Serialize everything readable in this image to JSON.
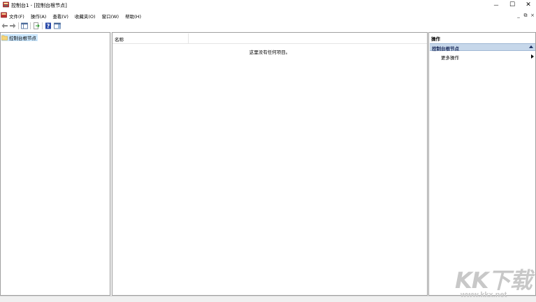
{
  "window": {
    "title": "控制台1 - [控制台根节点]",
    "minimize_glyph": "—",
    "maximize_glyph": "☐",
    "close_glyph": "✕"
  },
  "menubar": {
    "items": [
      "文件(F)",
      "操作(A)",
      "查看(V)",
      "收藏夹(O)",
      "窗口(W)",
      "帮助(H)"
    ],
    "mdi_minimize": "_",
    "mdi_restore": "⧉",
    "mdi_close": "×"
  },
  "toolbar": {
    "icons": [
      "back-arrow-icon",
      "forward-arrow-icon",
      "show-hide-console-tree-icon",
      "export-list-icon",
      "help-icon",
      "show-hide-action-pane-icon"
    ]
  },
  "tree": {
    "root_label": "控制台根节点"
  },
  "list": {
    "column_name": "名称",
    "empty_message": "这里没有任何项目。"
  },
  "actions": {
    "title": "操作",
    "section_label": "控制台根节点",
    "items": [
      {
        "label": "更多操作"
      }
    ]
  },
  "watermark": {
    "logo": "KK下载",
    "url": "www.kkx.net"
  },
  "colors": {
    "selection": "#cce8ff",
    "section_header": "#c6d7ea",
    "border": "#a0a0a0",
    "background": "#f0f0f0"
  }
}
